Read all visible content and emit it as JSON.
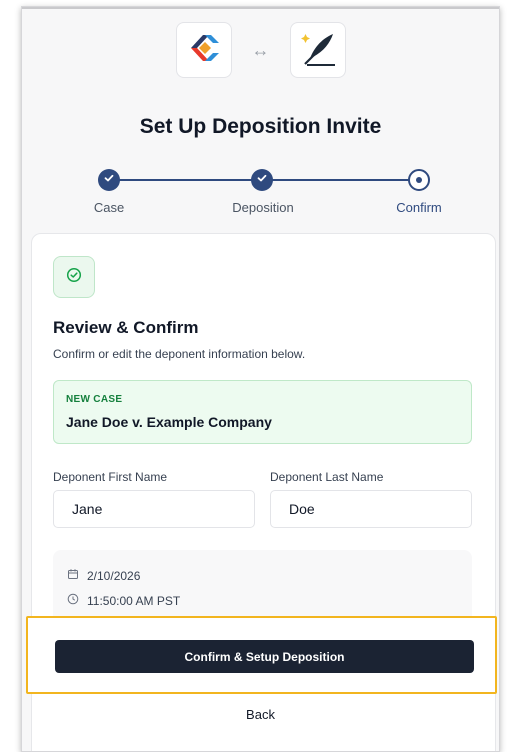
{
  "header": {
    "connector_arrow": "↔",
    "title": "Set Up Deposition Invite"
  },
  "stepper": {
    "steps": [
      {
        "label": "Case",
        "state": "done"
      },
      {
        "label": "Deposition",
        "state": "done"
      },
      {
        "label": "Confirm",
        "state": "current"
      }
    ]
  },
  "review": {
    "heading": "Review & Confirm",
    "subtitle": "Confirm or edit the deponent information below.",
    "case_tag": "NEW CASE",
    "case_name": "Jane Doe v. Example Company",
    "first_name_label": "Deponent First Name",
    "first_name_value": "Jane",
    "last_name_label": "Deponent Last Name",
    "last_name_value": "Doe",
    "date": "2/10/2026",
    "time": "11:50:00 AM PST"
  },
  "actions": {
    "confirm_label": "Confirm & Setup Deposition",
    "back_label": "Back"
  },
  "colors": {
    "primary": "#2f4a7f",
    "button_dark": "#1b2333",
    "success_bg": "#edfbf0",
    "success_text": "#15803d",
    "highlight": "#f2b51f"
  },
  "icons": [
    "source-app-logo-icon",
    "arrow-left-right-icon",
    "quill-feather-logo-icon",
    "check-icon",
    "check-circle-icon",
    "calendar-icon",
    "clock-icon"
  ]
}
